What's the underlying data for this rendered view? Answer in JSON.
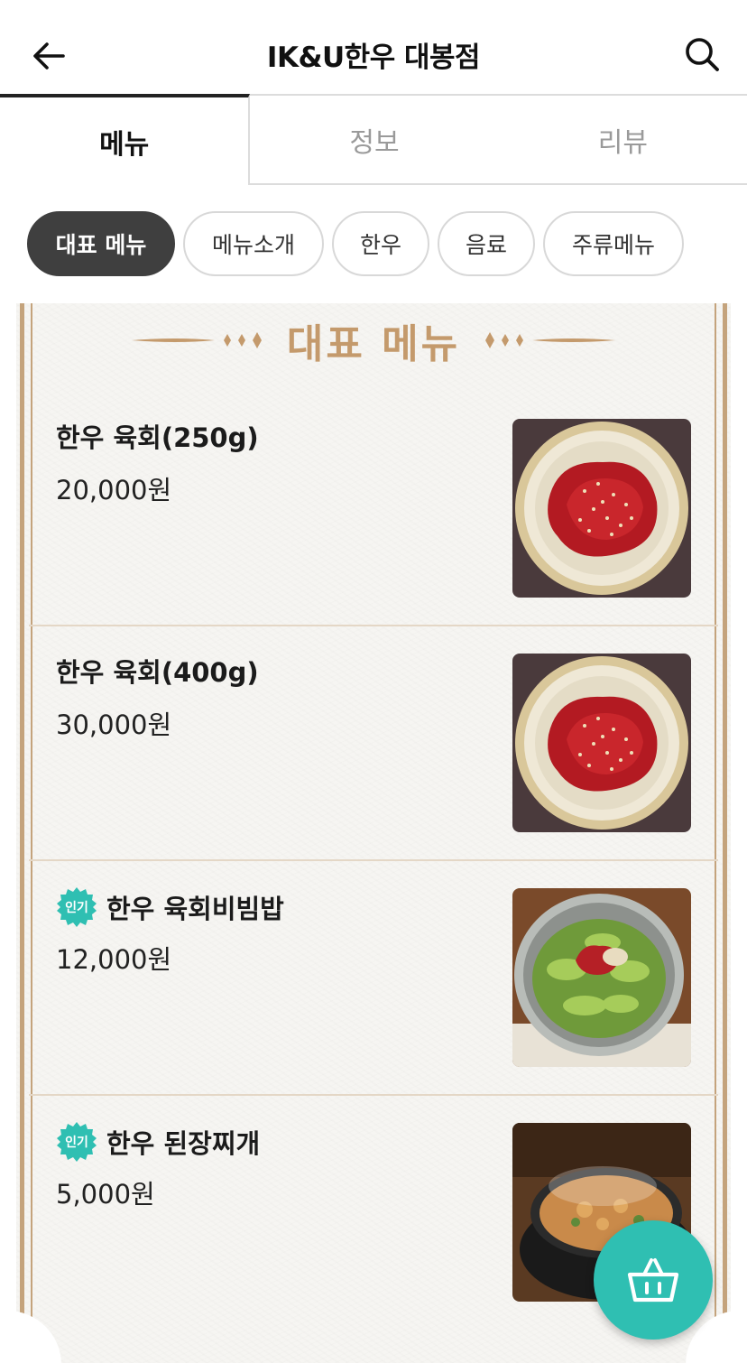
{
  "header": {
    "title": "IK&U한우 대봉점"
  },
  "tabs": [
    {
      "label": "메뉴",
      "active": true
    },
    {
      "label": "정보",
      "active": false
    },
    {
      "label": "리뷰",
      "active": false
    }
  ],
  "categories": [
    {
      "label": "대표 메뉴",
      "active": true
    },
    {
      "label": "메뉴소개",
      "active": false
    },
    {
      "label": "한우",
      "active": false
    },
    {
      "label": "음료",
      "active": false
    },
    {
      "label": "주류메뉴",
      "active": false
    }
  ],
  "section": {
    "title": "대표 메뉴"
  },
  "badge_label": "인기",
  "menu_items": [
    {
      "name": "한우 육회(250g)",
      "price": "20,000원",
      "popular": false,
      "photo": "yukhoe-plate"
    },
    {
      "name": "한우 육회(400g)",
      "price": "30,000원",
      "popular": false,
      "photo": "yukhoe-plate"
    },
    {
      "name": "한우 육회비빔밥",
      "price": "12,000원",
      "popular": true,
      "photo": "bibimbap-bowl"
    },
    {
      "name": "한우 된장찌개",
      "price": "5,000원",
      "popular": true,
      "photo": "doenjang-stew"
    }
  ],
  "colors": {
    "accent_teal": "#2fbfb2",
    "frame_gold": "#c4a37c",
    "chip_active": "#3f3f3f"
  },
  "icons": {
    "back": "arrow-left-icon",
    "search": "search-icon",
    "cart": "basket-icon"
  }
}
